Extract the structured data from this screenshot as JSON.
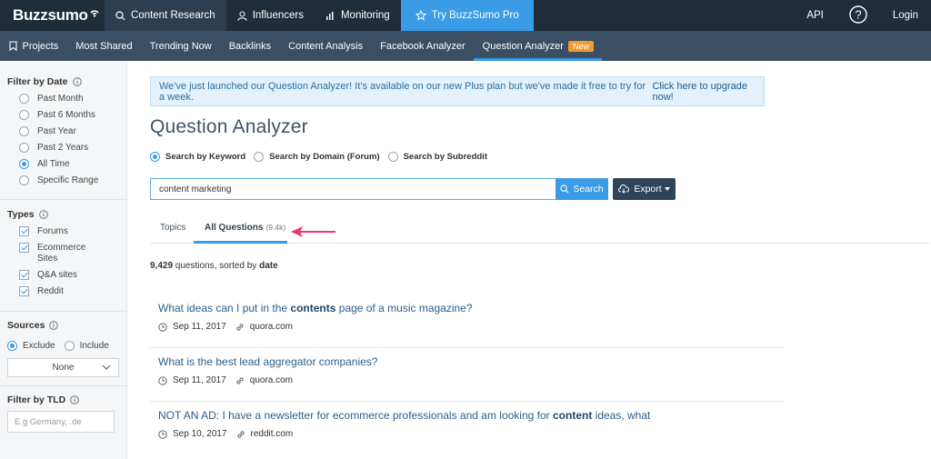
{
  "topnav": {
    "logo": "Buzzsumo",
    "items": [
      {
        "label": "Content Research"
      },
      {
        "label": "Influencers"
      },
      {
        "label": "Monitoring"
      },
      {
        "label": "Try BuzzSumo Pro"
      }
    ],
    "right": [
      {
        "label": "API"
      },
      {
        "label": "Login"
      }
    ]
  },
  "subnav": {
    "items": [
      {
        "label": "Projects"
      },
      {
        "label": "Most Shared"
      },
      {
        "label": "Trending Now"
      },
      {
        "label": "Backlinks"
      },
      {
        "label": "Content Analysis"
      },
      {
        "label": "Facebook Analyzer"
      },
      {
        "label": "Question Analyzer"
      }
    ],
    "new_badge": "New"
  },
  "sidebar": {
    "date": {
      "title": "Filter by Date",
      "options": [
        "Past Month",
        "Past 6 Months",
        "Past Year",
        "Past 2 Years",
        "All Time",
        "Specific Range"
      ],
      "selected": "All Time"
    },
    "types": {
      "title": "Types",
      "options": [
        "Forums",
        "Ecommerce",
        "Sites",
        "Q&A sites",
        "Reddit"
      ]
    },
    "sources": {
      "title": "Sources",
      "exclude": "Exclude",
      "include": "Include",
      "select_value": "None"
    },
    "tld": {
      "title": "Filter by TLD",
      "placeholder": "E.g Germany, .de"
    }
  },
  "main": {
    "banner": {
      "text": "We've just launched our Question Analyzer! It's available on our new Plus plan but we've made it free to try for a week. ",
      "link": "Click here to upgrade now!"
    },
    "title": "Question Analyzer",
    "search_modes": [
      "Search by Keyword",
      "Search by Domain (Forum)",
      "Search by Subreddit"
    ],
    "search_value": "content marketing",
    "search_button": "Search",
    "export_button": "Export",
    "tabs": {
      "topics": "Topics",
      "all_questions": "All Questions",
      "count": "(9.4k)"
    },
    "summary": {
      "count": "9,429",
      "middle": " questions, sorted by ",
      "sort": "date"
    },
    "questions": [
      {
        "pre": "What ideas can I put in the ",
        "bold": "contents",
        "post": " page of a music magazine?",
        "date": "Sep 11, 2017",
        "source": "quora.com"
      },
      {
        "pre": "What is the best lead aggregator companies?",
        "bold": "",
        "post": "",
        "date": "Sep 11, 2017",
        "source": "quora.com"
      },
      {
        "pre": "NOT AN AD: I have a newsletter for ecommerce professionals and am looking for ",
        "bold": "content",
        "post": " ideas, what",
        "date": "Sep 10, 2017",
        "source": "reddit.com"
      }
    ]
  },
  "colors": {
    "topnav_bg": "#1f2c3a",
    "subnav_bg": "#3a4f64",
    "accent": "#3a9be6",
    "badge": "#f29a2e"
  }
}
